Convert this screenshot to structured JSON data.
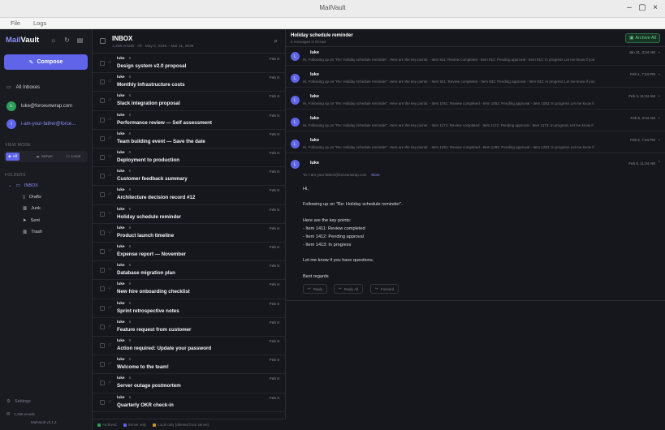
{
  "window": {
    "title": "MailVault",
    "controls": [
      "–",
      "▢",
      "×"
    ]
  },
  "menu": [
    "File",
    "Logs"
  ],
  "sidebar": {
    "logo_main": "Mail",
    "logo_accent": "Vault",
    "compose_label": "Compose",
    "all_inboxes": "All Inboxes",
    "accounts": [
      {
        "initial": "L",
        "email": "luke@forceunwrap.com",
        "color": "#2f9e5a"
      },
      {
        "initial": "I",
        "email": "i-am-your-father@force...",
        "color": "#5f64e8"
      }
    ],
    "view_mode_label": "VIEW MODE",
    "view_modes": [
      "All",
      "Server",
      "Local"
    ],
    "folders_label": "FOLDERS",
    "folders": [
      "INBOX",
      "Drafts",
      "Junk",
      "Sent",
      "Trash"
    ],
    "settings_label": "Settings",
    "emails_count": "1,288 emails",
    "version": "MailVault v2.1.4"
  },
  "list": {
    "title": "INBOX",
    "meta": "1,288 emails · All · May 5, 2025 – Mar 11, 2026",
    "rows": [
      {
        "sender": "luke",
        "count": "6",
        "subject": "Design system v2.0 proposal",
        "date": "Feb 6"
      },
      {
        "sender": "luke",
        "count": "6",
        "subject": "Monthly infrastructure costs",
        "date": "Feb 6"
      },
      {
        "sender": "luke",
        "count": "6",
        "subject": "Slack integration proposal",
        "date": "Feb 6"
      },
      {
        "sender": "luke",
        "count": "6",
        "subject": "Performance review — Self assessment",
        "date": "Feb 6"
      },
      {
        "sender": "luke",
        "count": "6",
        "subject": "Team building event — Save the date",
        "date": "Feb 6"
      },
      {
        "sender": "luke",
        "count": "6",
        "subject": "Deployment to production",
        "date": "Feb 6"
      },
      {
        "sender": "luke",
        "count": "6",
        "subject": "Customer feedback summary",
        "date": "Feb 6"
      },
      {
        "sender": "luke",
        "count": "6",
        "subject": "Architecture decision record #12",
        "date": "Feb 6"
      },
      {
        "sender": "luke",
        "count": "6",
        "subject": "Holiday schedule reminder",
        "date": "Feb 6"
      },
      {
        "sender": "luke",
        "count": "6",
        "subject": "Product launch timeline",
        "date": "Feb 6"
      },
      {
        "sender": "luke",
        "count": "6",
        "subject": "Expense report — November",
        "date": "Feb 6"
      },
      {
        "sender": "luke",
        "count": "6",
        "subject": "Database migration plan",
        "date": "Feb 6"
      },
      {
        "sender": "luke",
        "count": "6",
        "subject": "New hire onboarding checklist",
        "date": "Feb 6"
      },
      {
        "sender": "luke",
        "count": "6",
        "subject": "Sprint retrospective notes",
        "date": "Feb 6"
      },
      {
        "sender": "luke",
        "count": "6",
        "subject": "Feature request from customer",
        "date": "Feb 6"
      },
      {
        "sender": "luke",
        "count": "6",
        "subject": "Action required: Update your password",
        "date": "Feb 6"
      },
      {
        "sender": "luke",
        "count": "6",
        "subject": "Welcome to the team!",
        "date": "Feb 6"
      },
      {
        "sender": "luke",
        "count": "6",
        "subject": "Server outage postmortem",
        "date": "Feb 6"
      },
      {
        "sender": "luke",
        "count": "6",
        "subject": "Quarterly OKR check-in",
        "date": "Feb 6"
      }
    ],
    "footer": [
      "Archived",
      "Server only",
      "Local only (deleted from server)"
    ]
  },
  "thread": {
    "title": "Holiday schedule reminder",
    "subtitle": "6 messages in thread",
    "archive_label": "Archive All",
    "messages": [
      {
        "initial": "L",
        "name": "luke",
        "date": "Jan 31, 3:34 AM",
        "snippet": "Hi,  Following up on \"Re: Holiday schedule reminder\".  Here are the key points:  - Item 811: Review completed - Item 812: Pending approval - Item 813: In progress  Let me know if you"
      },
      {
        "initial": "L",
        "name": "luke",
        "date": "Feb 1, 7:34 PM",
        "snippet": "Hi,  Following up on \"Re: Holiday schedule reminder\".  Here are the key points:  - Item 931: Review completed - Item 932: Pending approval - Item 933: In progress  Let me know if you"
      },
      {
        "initial": "L",
        "name": "luke",
        "date": "Feb 3, 11:34 AM",
        "snippet": "Hi,  Following up on \"Re: Holiday schedule reminder\".  Here are the key points:  - Item 1051: Review completed - Item 1052: Pending approval - Item 1053: In progress  Let me know if"
      },
      {
        "initial": "L",
        "name": "luke",
        "date": "Feb 5, 3:34 AM",
        "snippet": "Hi,  Following up on \"Re: Holiday schedule reminder\".  Here are the key points:  - Item 1171: Review completed - Item 1172: Pending approval - Item 1173: In progress  Let me know if"
      },
      {
        "initial": "L",
        "name": "luke",
        "date": "Feb 6, 7:34 PM",
        "snippet": "Hi,  Following up on \"Re: Holiday schedule reminder\".  Here are the key points:  - Item 1291: Review completed - Item 1292: Pending approval - Item 1293: In progress  Let me know if"
      }
    ],
    "open": {
      "initial": "L",
      "name": "luke",
      "date": "Feb 8, 11:34 AM",
      "to": "To: i-am-your-father@forceunwrap.com",
      "more": "More",
      "body": [
        "Hi,",
        "Following up on \"Re: Holiday schedule reminder\".",
        "Here are the key points:",
        "- Item 1411: Review completed",
        "- Item 1412: Pending approval",
        "- Item 1413: In progress",
        "Let me know if you have questions.",
        "Best regards"
      ],
      "actions": [
        "Reply",
        "Reply All",
        "Forward"
      ]
    }
  }
}
